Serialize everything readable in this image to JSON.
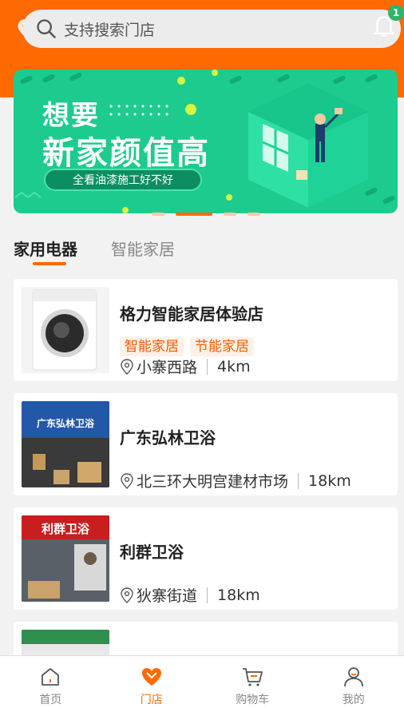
{
  "search": {
    "placeholder": "支持搜索门店"
  },
  "notifications": {
    "badge": "1"
  },
  "banner": {
    "title_line1": "想要",
    "title_line2": "新家颜值高",
    "subtitle": "全看油漆施工好不好"
  },
  "tabs": [
    {
      "label": "家用电器",
      "active": true
    },
    {
      "label": "智能家居",
      "active": false
    }
  ],
  "stores": [
    {
      "name": "格力智能家居体验店",
      "tags": [
        "智能家居",
        "节能家居"
      ],
      "address": "小寨西路",
      "distance": "4km"
    },
    {
      "name": "广东弘林卫浴",
      "tags": [],
      "address": "北三环大明宫建材市场",
      "distance": "18km",
      "sign_text": "广东弘林卫浴"
    },
    {
      "name": "利群卫浴",
      "tags": [],
      "address": "狄寨街道",
      "distance": "18km",
      "sign_text": "利群卫浴"
    }
  ],
  "nav": [
    {
      "label": "首页",
      "icon": "home-icon",
      "active": false
    },
    {
      "label": "门店",
      "icon": "store-heart-icon",
      "active": true
    },
    {
      "label": "购物车",
      "icon": "cart-icon",
      "active": false
    },
    {
      "label": "我的",
      "icon": "user-icon",
      "active": false
    }
  ],
  "colors": {
    "accent": "#ff6a00",
    "banner": "#1ccb8d",
    "tag_bg": "#fff1e8"
  }
}
